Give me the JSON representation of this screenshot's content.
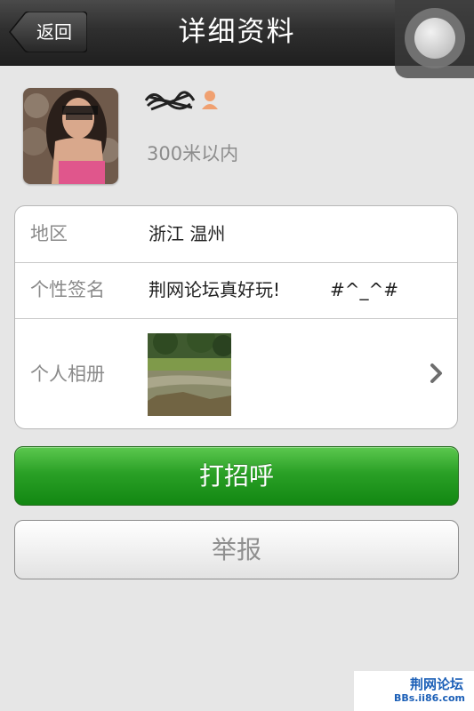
{
  "navbar": {
    "back_label": "返回",
    "title": "详细资料"
  },
  "profile": {
    "distance": "300米以内",
    "gender_icon": "person-icon"
  },
  "info": {
    "region": {
      "label": "地区",
      "value": "浙江 温州"
    },
    "signature": {
      "label": "个性签名",
      "value": "荆网论坛真好玩!",
      "value_extra": "#^_^#"
    },
    "album": {
      "label": "个人相册"
    }
  },
  "buttons": {
    "greet_label": "打招呼",
    "report_label": "举报"
  },
  "watermark": {
    "brand": "荆网论坛",
    "url": "BBs.ii86.com"
  },
  "colors": {
    "navbar": "#2f2f2f",
    "greet_button": "#2aa026",
    "background": "#e6e6e6",
    "watermark": "#1b5fb7"
  }
}
